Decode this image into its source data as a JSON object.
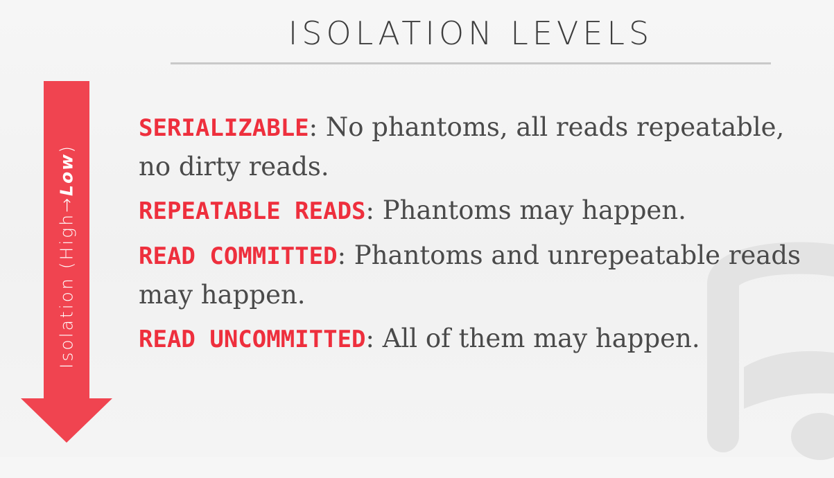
{
  "slide": {
    "title": "ISOLATION LEVELS",
    "arrow": {
      "label_prefix": "Isolation (High",
      "label_arrow": "→",
      "label_low": "Low",
      "label_suffix": ")",
      "color": "#F04450",
      "direction": "down"
    },
    "levels": [
      {
        "name": "SERIALIZABLE",
        "separator": ":",
        "description": " No phantoms, all reads repeatable, no dirty reads."
      },
      {
        "name": "REPEATABLE READS",
        "separator": ":",
        "description": " Phantoms may happen."
      },
      {
        "name": "READ COMMITTED",
        "separator": ":",
        "description": " Phantoms and unrepeatable reads may happen."
      },
      {
        "name": "READ UNCOMMITTED",
        "separator": ":",
        "description": " All of them may happen."
      }
    ],
    "colors": {
      "accent": "#EE2F3D",
      "text": "#4A4A4A",
      "title": "#3E3E3E",
      "rule": "#C9C9C9"
    }
  }
}
